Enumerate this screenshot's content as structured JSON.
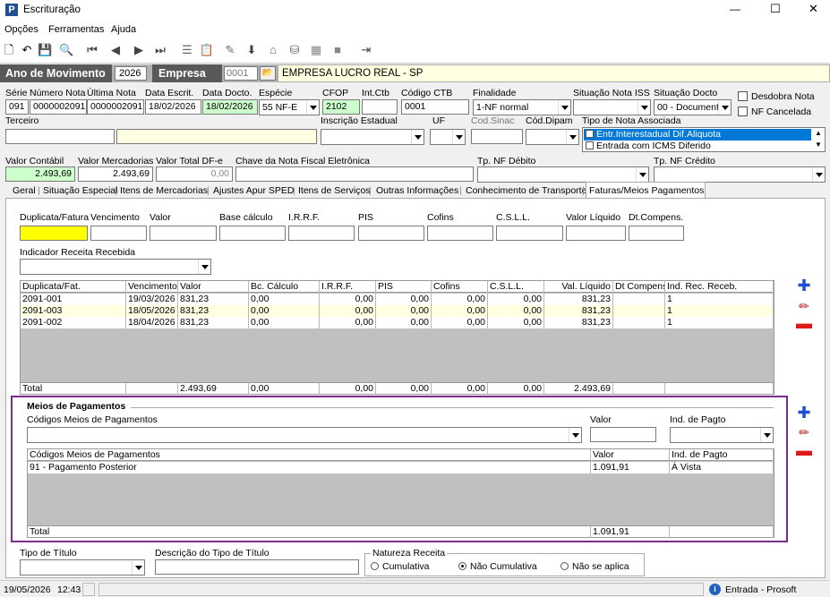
{
  "window": {
    "title": "Escrituração",
    "min": "—",
    "max": "☐",
    "close": "✕"
  },
  "menu": [
    "Opções",
    "Ferramentas",
    "Ajuda"
  ],
  "header": {
    "ano_label": "Ano de Movimento",
    "ano_value": "2026",
    "empresa_label": "Empresa",
    "empresa_code": "0001",
    "empresa_name": "EMPRESA LUCRO REAL - SP"
  },
  "fields": {
    "serie": {
      "label": "Série",
      "value": "091"
    },
    "numero_nota": {
      "label": "Número Nota",
      "value": "0000002091"
    },
    "ultima_nota": {
      "label": "Última Nota",
      "value": "0000002091"
    },
    "data_escrit": {
      "label": "Data Escrit.",
      "value": "18/02/2026"
    },
    "data_docto": {
      "label": "Data Docto.",
      "value": "18/02/2026"
    },
    "especie": {
      "label": "Espécie",
      "value": "55  NF-E"
    },
    "cfop": {
      "label": "CFOP",
      "value": "2102"
    },
    "int_ctb": {
      "label": "Int.Ctb",
      "value": ""
    },
    "codigo_ctb": {
      "label": "Código CTB",
      "value": "0001"
    },
    "finalidade": {
      "label": "Finalidade",
      "value": "1-NF normal"
    },
    "situacao_iss": {
      "label": "Situação Nota ISS",
      "value": ""
    },
    "situacao_docto": {
      "label": "Situação Docto",
      "value": "00 - Document"
    },
    "desdobra_nota": "Desdobra Nota",
    "nf_cancelada": "NF Cancelada",
    "terceiro": {
      "label": "Terceiro",
      "value": ""
    },
    "inscricao_estadual": {
      "label": "Inscrição Estadual"
    },
    "uf": {
      "label": "UF"
    },
    "cod_sinac": {
      "label": "Cod.Sinac"
    },
    "cod_dipam": {
      "label": "Cód.Dipam"
    },
    "tipo_nota_associada": {
      "label": "Tipo de Nota Associada",
      "options": [
        "Entr.Interestadual Dif.Aliquota",
        "Entrada com ICMS Diferido"
      ]
    },
    "valor_contabil": {
      "label": "Valor Contábil",
      "value": "2.493,69"
    },
    "valor_mercadorias": {
      "label": "Valor Mercadorias",
      "value": "2.493,69"
    },
    "valor_total_dfe": {
      "label": "Valor Total DF-e",
      "value": "0,00"
    },
    "chave_nfe": {
      "label": "Chave da Nota Fiscal Eletrônica",
      "value": ""
    },
    "tp_nf_debito": {
      "label": "Tp. NF Débito"
    },
    "tp_nf_credito": {
      "label": "Tp. NF Crédito"
    }
  },
  "tabs": [
    "Geral",
    "Situação Especial",
    "Itens de Mercadorias",
    "Ajustes Apur SPED",
    "Itens de Serviços",
    "Outras Informações",
    "Conhecimento de Transporte",
    "Faturas/Meios Pagamentos"
  ],
  "faturas": {
    "input_labels": [
      "Duplicata/Fatura",
      "Vencimento",
      "Valor",
      "Base cálculo",
      "I.R.R.F.",
      "PIS",
      "Cofins",
      "C.S.L.L.",
      "Valor Líquido",
      "Dt.Compens."
    ],
    "indicador_label": "Indicador Receita Recebida",
    "columns": [
      "Duplicata/Fat.",
      "Vencimento",
      "Valor",
      "Bc. Cálculo",
      "I.R.R.F.",
      "PIS",
      "Cofins",
      "C.S.L.L.",
      "Val. Líquido",
      "Dt Compens.",
      "Ind. Rec. Receb."
    ],
    "rows": [
      [
        "2091-001",
        "19/03/2026",
        "831,23",
        "0,00",
        "0,00",
        "0,00",
        "0,00",
        "0,00",
        "831,23",
        "",
        "1"
      ],
      [
        "2091-003",
        "18/05/2026",
        "831,23",
        "0,00",
        "0,00",
        "0,00",
        "0,00",
        "0,00",
        "831,23",
        "",
        "1"
      ],
      [
        "2091-002",
        "18/04/2026",
        "831,23",
        "0,00",
        "0,00",
        "0,00",
        "0,00",
        "0,00",
        "831,23",
        "",
        "1"
      ]
    ],
    "total": [
      "Total",
      "",
      "2.493,69",
      "0,00",
      "0,00",
      "0,00",
      "0,00",
      "0,00",
      "2.493,69",
      "",
      ""
    ]
  },
  "meios": {
    "title": "Meios de Pagamentos",
    "codigos_label": "Códigos Meios de Pagamentos",
    "valor_label": "Valor",
    "ind_label": "Ind. de Pagto",
    "columns": [
      "Códigos Meios de Pagamentos",
      "Valor",
      "Ind. de Pagto"
    ],
    "rows": [
      [
        "91 - Pagamento Posterior",
        "1.091,91",
        "À Vista"
      ]
    ],
    "total": [
      "Total",
      "1.091,91",
      ""
    ]
  },
  "bottom": {
    "tipo_titulo_label": "Tipo de Título",
    "descricao_label": "Descrição do Tipo de Título",
    "natureza_label": "Natureza Receita",
    "natureza_options": [
      "Cumulativa",
      "Não Cumulativa",
      "Não se aplica"
    ]
  },
  "status": {
    "date": "19/05/2026",
    "time": "12:43",
    "mode": "Entrada - Prosoft"
  }
}
